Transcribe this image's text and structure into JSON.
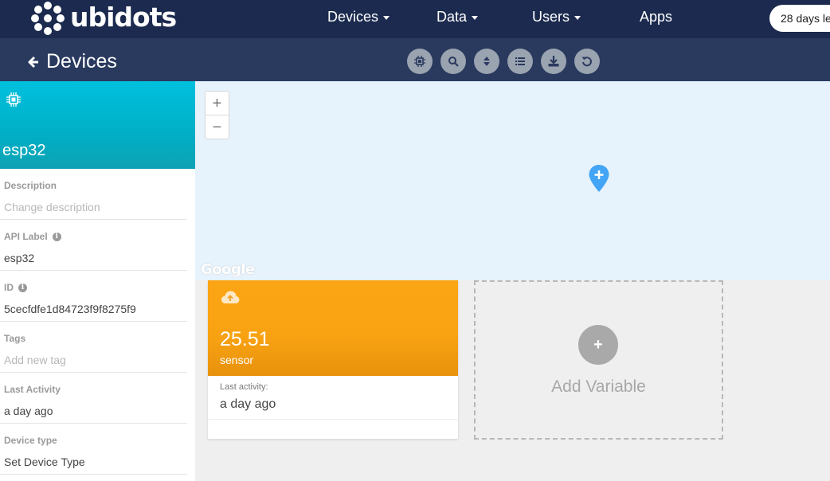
{
  "topnav": {
    "logo_text": "ubidots",
    "items": [
      {
        "label": "Devices",
        "dropdown": true
      },
      {
        "label": "Data",
        "dropdown": true
      },
      {
        "label": "Users",
        "dropdown": true
      },
      {
        "label": "Apps",
        "dropdown": false
      }
    ],
    "trial_badge": "28 days le"
  },
  "subheader": {
    "title": "Devices",
    "tools": [
      "chip-icon",
      "search-icon",
      "sort-icon",
      "list-icon",
      "download-icon",
      "refresh-icon"
    ]
  },
  "device": {
    "name": "esp32",
    "fields": [
      {
        "label": "Description",
        "value": "Change description",
        "placeholder": true,
        "info": false
      },
      {
        "label": "API Label",
        "value": "esp32",
        "placeholder": false,
        "info": true
      },
      {
        "label": "ID",
        "value": "5cecfdfe1d84723f9f8275f9",
        "placeholder": false,
        "info": true
      },
      {
        "label": "Tags",
        "value": "Add new tag",
        "placeholder": true,
        "info": false
      },
      {
        "label": "Last Activity",
        "value": "a day ago",
        "placeholder": false,
        "info": false
      },
      {
        "label": "Device type",
        "value": "Set Device Type",
        "placeholder": false,
        "info": false
      }
    ]
  },
  "map": {
    "zoom_in": "+",
    "zoom_out": "−",
    "attribution": "Google"
  },
  "variable": {
    "value": "25.51",
    "name": "sensor",
    "last_activity_label": "Last activity:",
    "last_activity_value": "a day ago",
    "color": "#fba514"
  },
  "add_variable": {
    "icon": "+",
    "label": "Add Variable"
  },
  "colors": {
    "nav_bg": "#1b2a4e",
    "subheader_bg": "#2a3a5e",
    "device_header": "#00c0de",
    "map_bg": "#e6f3fd",
    "pin": "#42a5f5"
  }
}
